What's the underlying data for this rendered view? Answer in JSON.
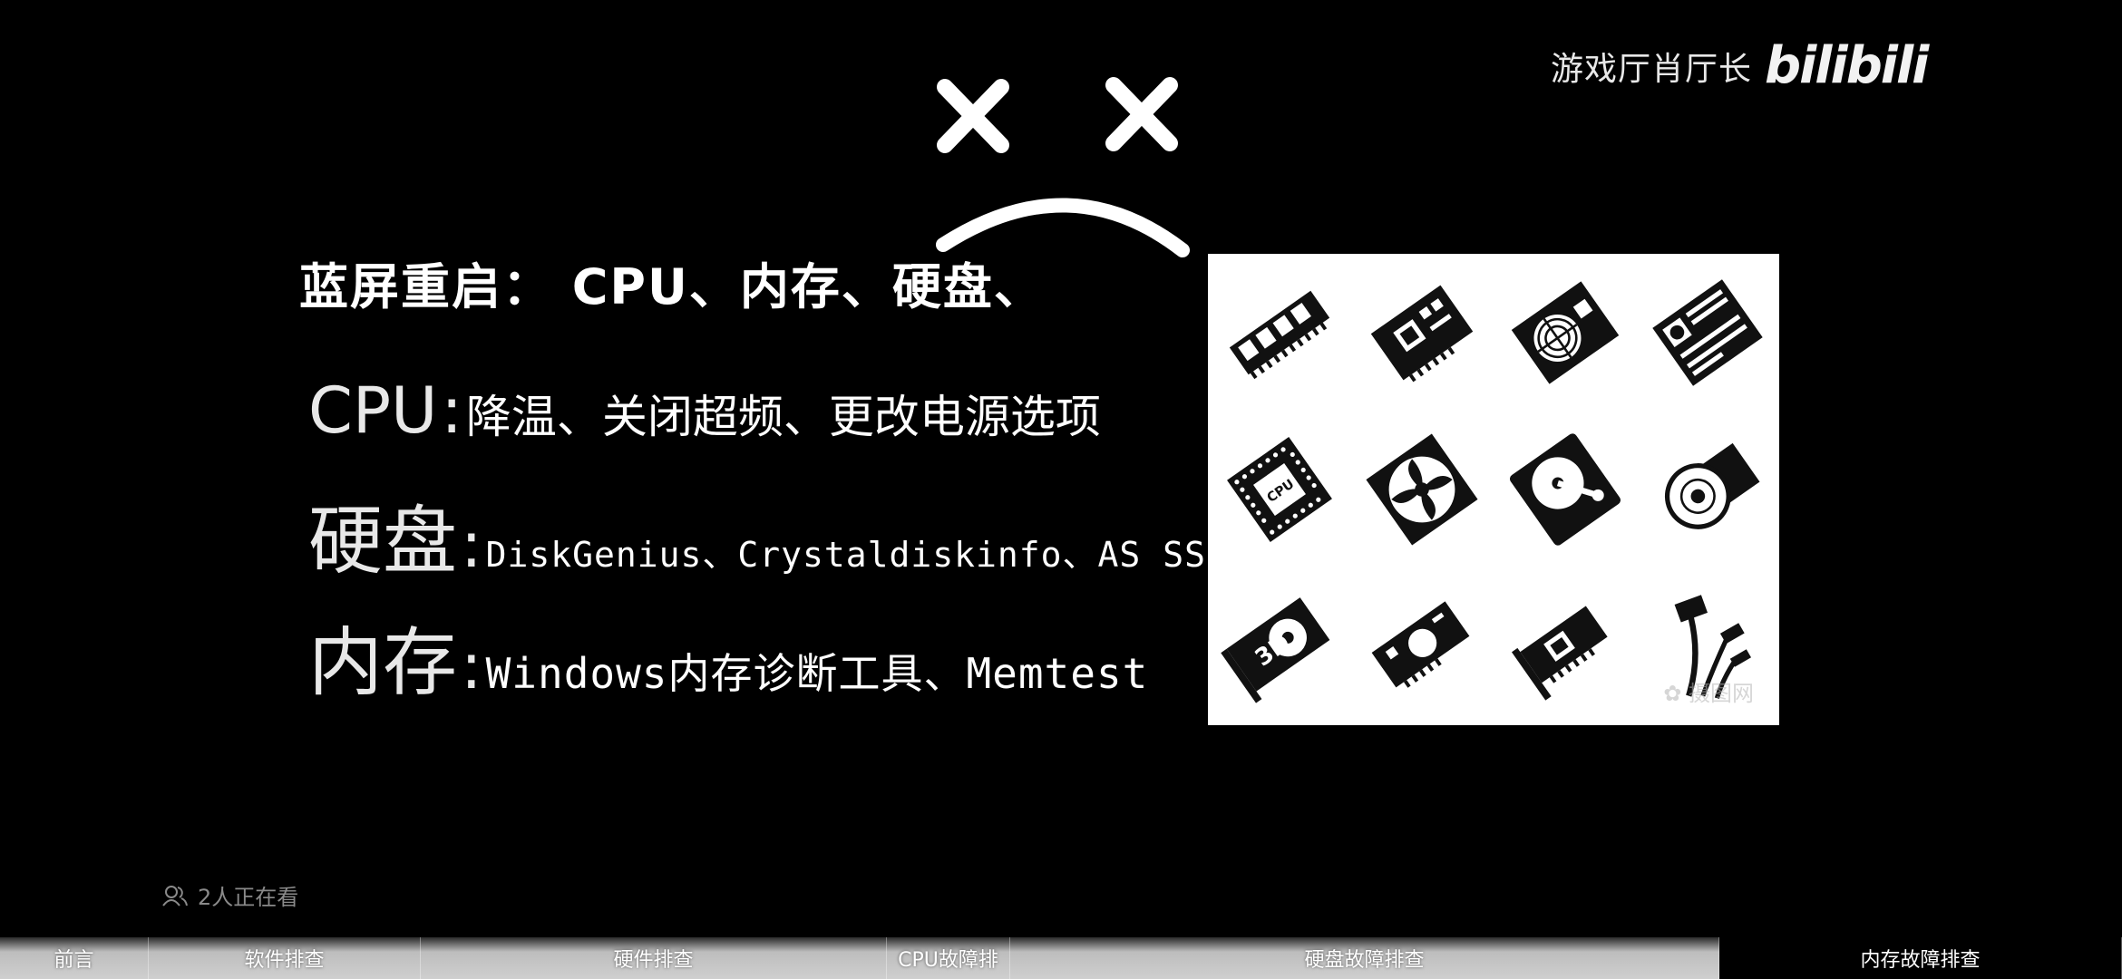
{
  "watermark": {
    "channel": "游戏厅肖厅长",
    "logo": "bilibili"
  },
  "slide": {
    "title": "蓝屏重启： CPU、内存、硬盘、",
    "rows": [
      {
        "key": "CPU",
        "value": "降温、关闭超频、更改电源选项"
      },
      {
        "key": "硬盘",
        "value": "DiskGenius、Crystaldiskinfo、AS SSD"
      },
      {
        "key": "内存",
        "value": "Windows内存诊断工具、Memtest"
      }
    ],
    "image_watermark": "✿ 摄图网"
  },
  "viewers": {
    "text": "2人正在看",
    "icon": "viewers-icon"
  },
  "chapters": [
    {
      "label": "前言",
      "active": false
    },
    {
      "label": "软件排查",
      "active": false
    },
    {
      "label": "硬件排查",
      "active": false
    },
    {
      "label": "CPU故障排",
      "active": false
    },
    {
      "label": "硬盘故障排查",
      "active": false
    },
    {
      "label": "内存故障排查",
      "active": true
    }
  ],
  "colors": {
    "background": "#000000",
    "active_chapter": "#000000"
  },
  "icons": [
    "ram-icon",
    "motherboard-icon",
    "psu-icon",
    "mainboard-icon",
    "cpu-chip-icon",
    "cooling-fan-icon",
    "hard-drive-icon",
    "optical-drive-icon",
    "gpu-3d-card-icon",
    "video-card-icon",
    "expansion-card-icon",
    "cables-icon"
  ]
}
